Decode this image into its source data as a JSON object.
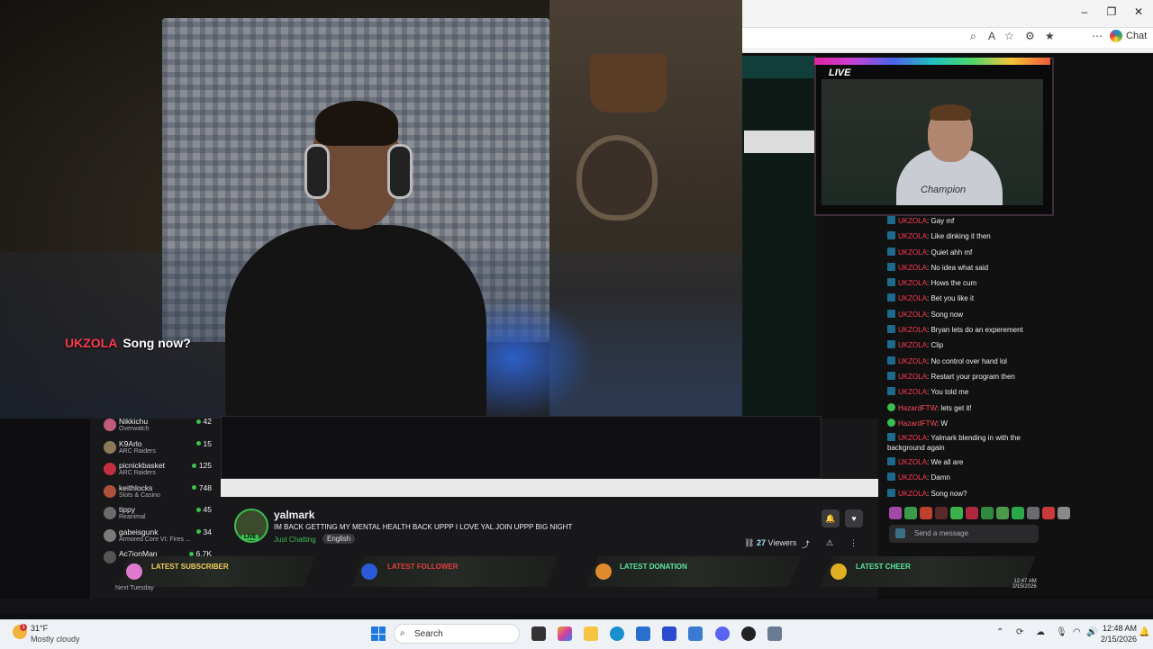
{
  "webcam": {
    "chat_overlay": {
      "username": "UKZOLA",
      "message": "Song now?"
    }
  },
  "browser": {
    "window_controls": [
      "–",
      "❐",
      "✕"
    ],
    "chat_button_label": "Chat"
  },
  "nested_stream": {
    "live_label": "LIVE",
    "shirt_text": "Champion"
  },
  "chat": {
    "messages": [
      {
        "user": "UKZOLA",
        "text": "Gay mf",
        "badge": "blue"
      },
      {
        "user": "UKZOLA",
        "text": "Like dinking it then",
        "badge": "blue"
      },
      {
        "user": "UKZOLA",
        "text": "Quiet ahh mf",
        "badge": "blue"
      },
      {
        "user": "UKZOLA",
        "text": "No idea what said",
        "badge": "blue"
      },
      {
        "user": "UKZOLA",
        "text": "Hows the cum",
        "badge": "blue"
      },
      {
        "user": "UKZOLA",
        "text": "Bet you like it",
        "badge": "blue"
      },
      {
        "user": "UKZOLA",
        "text": "Song now",
        "badge": "blue"
      },
      {
        "user": "UKZOLA",
        "text": "Bryan lets do an experement",
        "badge": "blue"
      },
      {
        "user": "UKZOLA",
        "text": "Clip",
        "badge": "blue"
      },
      {
        "user": "UKZOLA",
        "text": "No control over hand lol",
        "badge": "blue"
      },
      {
        "user": "UKZOLA",
        "text": "Restart your program then",
        "badge": "blue"
      },
      {
        "user": "UKZOLA",
        "text": "You told me",
        "badge": "blue"
      },
      {
        "user": "HazardFTW",
        "text": "lets get it!",
        "badge": "green"
      },
      {
        "user": "HazardFTW",
        "text": "W",
        "badge": "green"
      },
      {
        "user": "UKZOLA",
        "text": "Yalmark blending in with the background again",
        "badge": "blue"
      },
      {
        "user": "UKZOLA",
        "text": "We all are",
        "badge": "blue"
      },
      {
        "user": "UKZOLA",
        "text": "Damn",
        "badge": "blue"
      },
      {
        "user": "UKZOLA",
        "text": "Song now?",
        "badge": "blue"
      }
    ],
    "send_placeholder": "Send a message"
  },
  "leaderboard": [
    {
      "name": "Nikkichu",
      "game": "Overwatch",
      "value": "42",
      "color": "#c25a7a"
    },
    {
      "name": "K9Arlo",
      "game": "ARC Raiders",
      "value": "15",
      "color": "#8a7a5a"
    },
    {
      "name": "picnickbasket",
      "game": "ARC Raiders",
      "value": "125",
      "color": "#c03040"
    },
    {
      "name": "keithlocks",
      "game": "Slots & Casino",
      "value": "748",
      "color": "#b0503a"
    },
    {
      "name": "tippy",
      "game": "Reanimal",
      "value": "45",
      "color": "#6a6a6a"
    },
    {
      "name": "gabeisgunk",
      "game": "Armored Core VI: Fires ...",
      "value": "34",
      "color": "#7a7a7a"
    },
    {
      "name": "Ac7ionMan",
      "game": "",
      "value": "6.7K",
      "color": "#555"
    }
  ],
  "stream_info": {
    "streamer": "yalmark",
    "title": "IM BACK GETTING MY MENTAL HEALTH BACK UPPP I LOVE YAL JOIN UPPP BIG NIGHT",
    "category": "Just Chatting",
    "tag": "English",
    "live_badge": "LIVE",
    "viewers": "27",
    "viewers_label": "Viewers"
  },
  "alerts": {
    "subscriber": "LATEST SUBSCRIBER",
    "follower": "LATEST FOLLOWER",
    "donation": "LATEST DONATION",
    "cheer": "LATEST CHEER",
    "next_text": "Next Tuesday"
  },
  "taskbar": {
    "weather_temp": "31°F",
    "weather_desc": "Mostly cloudy",
    "weather_badge": "1",
    "search_label": "Search",
    "time": "12:48 AM",
    "date": "2/15/2026",
    "mini_time": "12:47 AM",
    "mini_date": "2/15/2026"
  }
}
